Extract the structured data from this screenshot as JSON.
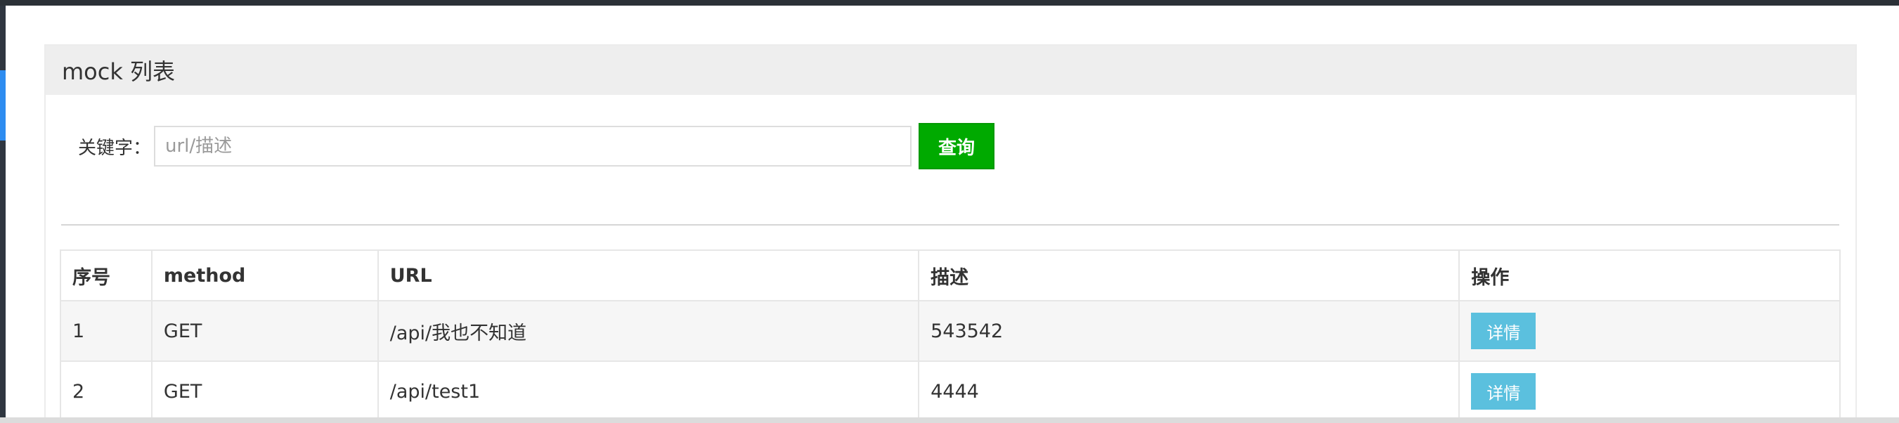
{
  "panel": {
    "title": "mock 列表"
  },
  "search": {
    "label": "关键字：",
    "placeholder": "url/描述",
    "value": "",
    "button_label": "查询"
  },
  "table": {
    "headers": [
      "序号",
      "method",
      "URL",
      "描述",
      "操作"
    ],
    "rows": [
      {
        "index": "1",
        "method": "GET",
        "url": "/api/我也不知道",
        "description": "543542",
        "action_label": "详情"
      },
      {
        "index": "2",
        "method": "GET",
        "url": "/api/test1",
        "description": "4444",
        "action_label": "详情"
      }
    ]
  },
  "colors": {
    "accent_blue": "#2d8cf0",
    "search_button_green": "#00aa00",
    "detail_button_blue": "#5bc0de",
    "header_bg": "#eeeeee"
  }
}
